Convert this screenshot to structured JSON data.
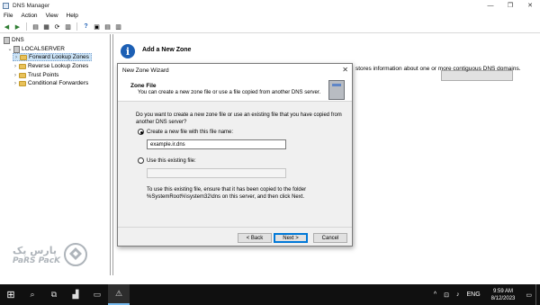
{
  "window": {
    "title": "DNS Manager",
    "controls": [
      "—",
      "❐",
      "✕"
    ]
  },
  "menu": [
    "File",
    "Action",
    "View",
    "Help"
  ],
  "toolbar": [
    "◀",
    "▶",
    "▤",
    "▦",
    "⟳",
    "▥",
    "?",
    "▣",
    "▤",
    "▥"
  ],
  "tree": {
    "root": "DNS",
    "server": "LOCALSERVER",
    "items": [
      "Forward Lookup Zones",
      "Reverse Lookup Zones",
      "Trust Points",
      "Conditional Forwarders"
    ],
    "selected_index": 0
  },
  "right": {
    "title": "Add a New Zone",
    "text": "stores information about one or more contiguous DNS domains."
  },
  "watermark": {
    "text1": "پارس پک",
    "text2": "PaRS PacK"
  },
  "dialog": {
    "title": "New Zone Wizard",
    "close": "✕",
    "header_title": "Zone File",
    "header_desc": "You can create a new zone file or use a file copied from another DNS server.",
    "question": "Do you want to create a new zone file or use an existing file that you have copied from another DNS server?",
    "option_new": "Create a new file with this file name:",
    "file_name": "example.ir.dns",
    "option_existing": "Use this existing file:",
    "existing_value": "",
    "note": "To use this existing file, ensure that it has been copied to the folder %SystemRoot%\\system32\\dns on this server, and then click Next.",
    "back": "< Back",
    "next": "Next >",
    "cancel": "Cancel"
  },
  "taskbar": {
    "start": "⊞",
    "apps": [
      "⌕",
      "⧉",
      "▟",
      "▭",
      "⚠"
    ],
    "tray_caret": "^",
    "network": "⊡",
    "volume": "♪",
    "lang": "ENG",
    "time": "9:59 AM",
    "date": "8/12/2023"
  }
}
